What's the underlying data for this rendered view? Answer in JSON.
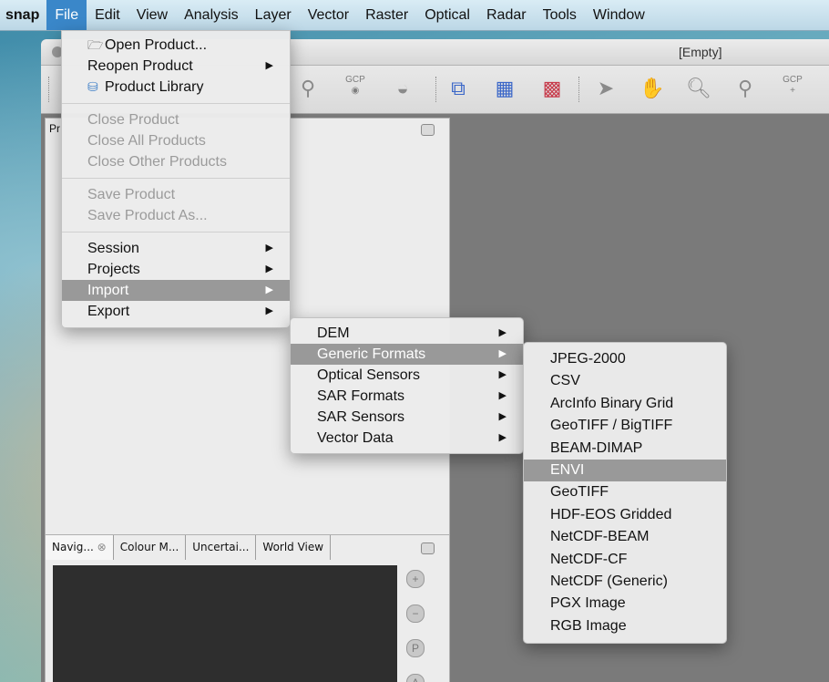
{
  "menubar": {
    "app": "snap",
    "items": [
      "File",
      "Edit",
      "View",
      "Analysis",
      "Layer",
      "Vector",
      "Raster",
      "Optical",
      "Radar",
      "Tools",
      "Window"
    ],
    "active_index": 0
  },
  "window": {
    "title": "[Empty]",
    "product_panel_tab": "Pr",
    "bottom_tabs": [
      "Navig...",
      "Colour M...",
      "Uncertai...",
      "World View"
    ]
  },
  "toolbar": {
    "gcp_label": "GCP"
  },
  "file_menu": {
    "items": [
      {
        "label": "Open Product...",
        "icon": "folder-icon",
        "enabled": true
      },
      {
        "label": "Reopen Product",
        "enabled": true,
        "submenu": true
      },
      {
        "label": "Product Library",
        "icon": "library-icon",
        "enabled": true
      },
      {
        "label": "Close Product",
        "enabled": false
      },
      {
        "label": "Close All Products",
        "enabled": false
      },
      {
        "label": "Close Other Products",
        "enabled": false
      },
      {
        "label": "Save Product",
        "enabled": false
      },
      {
        "label": "Save Product As...",
        "enabled": false
      },
      {
        "label": "Session",
        "enabled": true,
        "submenu": true
      },
      {
        "label": "Projects",
        "enabled": true,
        "submenu": true
      },
      {
        "label": "Import",
        "enabled": true,
        "submenu": true,
        "highlighted": true
      },
      {
        "label": "Export",
        "enabled": true,
        "submenu": true
      }
    ]
  },
  "import_menu": {
    "items": [
      {
        "label": "DEM",
        "highlighted": false
      },
      {
        "label": "Generic Formats",
        "highlighted": true
      },
      {
        "label": "Optical Sensors",
        "highlighted": false
      },
      {
        "label": "SAR Formats",
        "highlighted": false
      },
      {
        "label": "SAR Sensors",
        "highlighted": false
      },
      {
        "label": "Vector Data",
        "highlighted": false
      }
    ]
  },
  "generic_formats_menu": {
    "items": [
      {
        "label": "JPEG-2000",
        "highlighted": false
      },
      {
        "label": "CSV",
        "highlighted": false
      },
      {
        "label": "ArcInfo Binary Grid",
        "highlighted": false
      },
      {
        "label": "GeoTIFF / BigTIFF",
        "highlighted": false
      },
      {
        "label": "BEAM-DIMAP",
        "highlighted": false
      },
      {
        "label": "ENVI",
        "highlighted": true
      },
      {
        "label": "GeoTIFF",
        "highlighted": false
      },
      {
        "label": "HDF-EOS Gridded",
        "highlighted": false
      },
      {
        "label": "NetCDF-BEAM",
        "highlighted": false
      },
      {
        "label": "NetCDF-CF",
        "highlighted": false
      },
      {
        "label": "NetCDF (Generic)",
        "highlighted": false
      },
      {
        "label": "PGX Image",
        "highlighted": false
      },
      {
        "label": "RGB Image",
        "highlighted": false
      }
    ]
  },
  "colors": {
    "menubar_active": "#3a87c9",
    "menu_highlight": "#999999"
  }
}
